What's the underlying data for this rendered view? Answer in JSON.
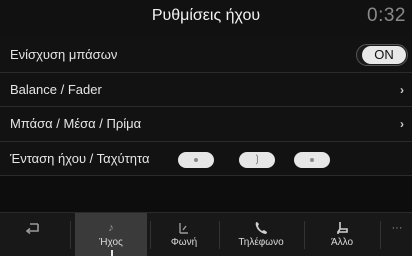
{
  "header": {
    "title": "Ρυθμίσεις ήχου",
    "time": "0:32"
  },
  "settings": {
    "bass_boost": {
      "label": "Ενίσχυση μπάσων",
      "toggle": "ON"
    },
    "balance": {
      "label": "Balance / Fader",
      "chevron": "›"
    },
    "eq": {
      "label": "Μπάσα / Μέσα / Πρίμα",
      "chevron": "›"
    },
    "speed_volume": {
      "label": "Ένταση ήχου / Ταχύτητα",
      "levels": 3,
      "selected": 2
    }
  },
  "tabs": {
    "back": {
      "label": ""
    },
    "sound": {
      "label": "Ήχος"
    },
    "voice": {
      "label": "Φωνή"
    },
    "phone": {
      "label": "Τηλέφωνο"
    },
    "other": {
      "label": "Άλλο"
    },
    "more": {
      "label": ""
    }
  },
  "icons": {
    "back": "back-arrow-icon",
    "sound": "music-note-icon",
    "voice": "voice-icon",
    "phone": "phone-icon",
    "other": "car-seat-icon",
    "more": "more-icon"
  }
}
